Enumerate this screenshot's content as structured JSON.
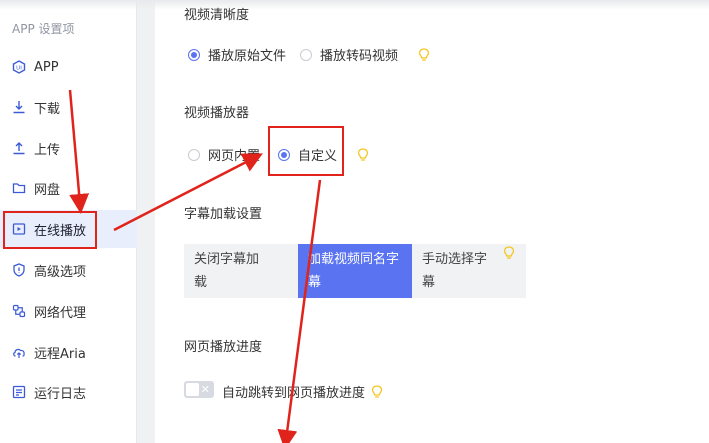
{
  "sidebar": {
    "title": "APP 设置项",
    "items": [
      {
        "label": "APP",
        "icon": "app-icon"
      },
      {
        "label": "下载",
        "icon": "download-icon"
      },
      {
        "label": "上传",
        "icon": "upload-icon"
      },
      {
        "label": "网盘",
        "icon": "folder-icon"
      },
      {
        "label": "在线播放",
        "icon": "play-icon",
        "active": true
      },
      {
        "label": "高级选项",
        "icon": "shield-icon"
      },
      {
        "label": "网络代理",
        "icon": "proxy-icon"
      },
      {
        "label": "远程Aria",
        "icon": "cloud-icon"
      },
      {
        "label": "运行日志",
        "icon": "log-icon"
      }
    ]
  },
  "main": {
    "clarity": {
      "title": "视频清晰度",
      "option1": "播放原始文件",
      "option2": "播放转码视频",
      "selected": "播放原始文件"
    },
    "player": {
      "title": "视频播放器",
      "option1": "网页内置",
      "option2": "自定义",
      "selected": "自定义"
    },
    "subtitle": {
      "title": "字幕加载设置",
      "options": [
        "关闭字幕加载",
        "加载视频同名字幕",
        "手动选择字幕"
      ],
      "opt1_line1": "关闭字幕加",
      "opt1_line2": "载",
      "opt2_line1": "加载视频同名字",
      "opt2_line2": "幕",
      "opt3_line1": "手动选择字",
      "opt3_line2": "幕",
      "selected": "加载视频同名字幕"
    },
    "progress": {
      "title": "网页播放进度",
      "toggle_label": "自动跳转到网页播放进度",
      "toggle_on": false
    }
  },
  "colors": {
    "accent": "#5a73f0",
    "annotation": "#e0241b",
    "bulb": "#f3c623"
  }
}
